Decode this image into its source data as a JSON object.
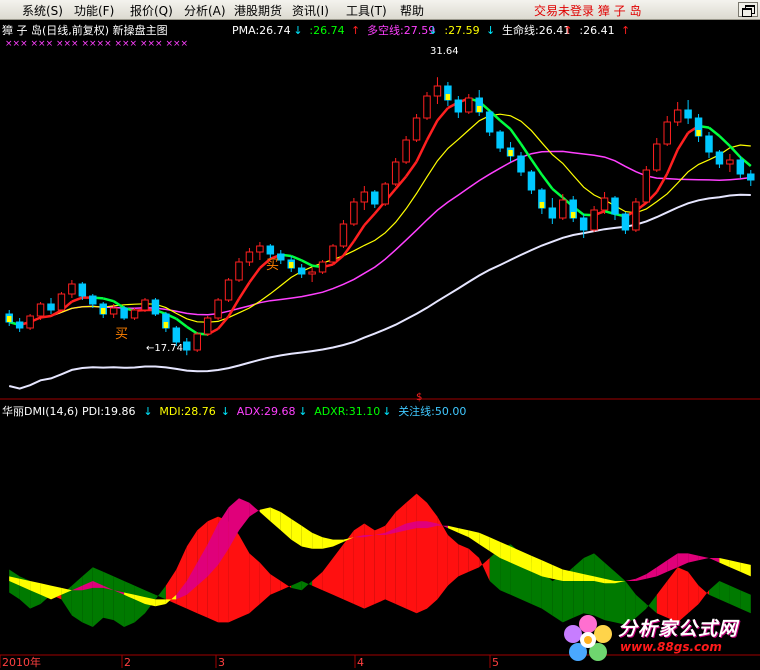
{
  "menu": {
    "items": [
      "系统(S)",
      "功能(F)",
      "报价(Q)",
      "分析(A)",
      "港股期货",
      "资讯(I)",
      "工具(T)",
      "帮助"
    ],
    "login_status": "交易未登录",
    "stock_name": "獐 子 岛"
  },
  "main_panel": {
    "title": "獐 子 岛(日线,前复权) 新操盘主图",
    "markers": "×××  ×××  ×××  ××××  ×××  ×××  ×××",
    "indicators": [
      {
        "label": "PMA:26.74",
        "arrow": "↓",
        "color": "#ffffff",
        "arrow_color": "#00e8ff"
      },
      {
        "label": ":26.74",
        "arrow": "↑",
        "color": "#00ff00",
        "arrow_color": "#ff2020"
      },
      {
        "label": "多空线:27.59",
        "arrow": "↓",
        "color": "#ff40ff",
        "arrow_color": "#00e8ff"
      },
      {
        "label": ":27.59",
        "arrow": "↓",
        "color": "#ffff00",
        "arrow_color": "#00e8ff"
      },
      {
        "label": "生命线:26.41",
        "arrow": "↑",
        "color": "#ffffff",
        "arrow_color": "#ff2020"
      },
      {
        "label": ":26.41",
        "arrow": "↑",
        "color": "#ffffff",
        "arrow_color": "#ff2020"
      }
    ],
    "high_label": "31.64",
    "low_label": "←17.74",
    "buy_label": "买"
  },
  "dmi_panel": {
    "title": "华丽DMI(14,6)",
    "indicators": [
      {
        "label": "PDI:19.86",
        "arrow": "↓",
        "color": "#ffffff"
      },
      {
        "label": "MDI:28.76",
        "arrow": "↓",
        "color": "#ffff00"
      },
      {
        "label": "ADX:29.68",
        "arrow": "↓",
        "color": "#ff40ff"
      },
      {
        "label": "ADXR:31.10",
        "arrow": "↓",
        "color": "#00ff00"
      },
      {
        "label": "关注线:50.00",
        "arrow": "",
        "color": "#40c8ff"
      }
    ]
  },
  "axis": {
    "ticks": [
      "2010年",
      "2",
      "3",
      "4",
      "5"
    ]
  },
  "watermark": {
    "title": "分析家公式网",
    "url": "www.88gs.com"
  },
  "chart_data": {
    "type": "candlestick",
    "price_scale_labels": {
      "high": 31.64,
      "low": 17.74
    },
    "ylim": [
      16.0,
      33.5
    ],
    "candles": [
      [
        19.8,
        20.0,
        19.2,
        19.4
      ],
      [
        19.4,
        19.6,
        18.9,
        19.1
      ],
      [
        19.1,
        19.8,
        19.0,
        19.7
      ],
      [
        19.7,
        20.4,
        19.5,
        20.3
      ],
      [
        20.3,
        20.6,
        19.8,
        20.0
      ],
      [
        20.0,
        20.9,
        19.9,
        20.8
      ],
      [
        20.8,
        21.5,
        20.6,
        21.3
      ],
      [
        21.3,
        21.4,
        20.5,
        20.7
      ],
      [
        20.7,
        20.8,
        20.1,
        20.3
      ],
      [
        20.3,
        20.4,
        19.6,
        19.8
      ],
      [
        19.8,
        20.3,
        19.6,
        20.1
      ],
      [
        20.1,
        20.2,
        19.5,
        19.6
      ],
      [
        19.6,
        20.1,
        19.5,
        20.0
      ],
      [
        20.0,
        20.6,
        19.9,
        20.5
      ],
      [
        20.5,
        20.6,
        19.7,
        19.8
      ],
      [
        19.8,
        19.9,
        18.9,
        19.1
      ],
      [
        19.1,
        19.2,
        18.2,
        18.4
      ],
      [
        18.4,
        18.6,
        17.74,
        18.0
      ],
      [
        18.0,
        18.9,
        17.9,
        18.8
      ],
      [
        18.8,
        19.7,
        18.7,
        19.6
      ],
      [
        19.6,
        20.6,
        19.5,
        20.5
      ],
      [
        20.5,
        21.6,
        20.4,
        21.5
      ],
      [
        21.5,
        22.6,
        21.4,
        22.4
      ],
      [
        22.4,
        23.1,
        22.2,
        22.9
      ],
      [
        22.9,
        23.4,
        22.5,
        23.2
      ],
      [
        23.2,
        23.3,
        22.6,
        22.8
      ],
      [
        22.8,
        23.0,
        22.3,
        22.5
      ],
      [
        22.5,
        22.7,
        21.9,
        22.1
      ],
      [
        22.1,
        22.3,
        21.6,
        21.8
      ],
      [
        21.8,
        22.1,
        21.4,
        21.9
      ],
      [
        21.9,
        22.5,
        21.8,
        22.4
      ],
      [
        22.4,
        23.3,
        22.3,
        23.2
      ],
      [
        23.2,
        24.5,
        23.1,
        24.3
      ],
      [
        24.3,
        25.6,
        24.2,
        25.4
      ],
      [
        25.4,
        26.2,
        25.0,
        25.9
      ],
      [
        25.9,
        26.0,
        25.1,
        25.3
      ],
      [
        25.3,
        26.4,
        25.2,
        26.3
      ],
      [
        26.3,
        27.6,
        26.2,
        27.4
      ],
      [
        27.4,
        28.7,
        27.3,
        28.5
      ],
      [
        28.5,
        29.8,
        28.4,
        29.6
      ],
      [
        29.6,
        30.9,
        29.5,
        30.7
      ],
      [
        30.7,
        31.64,
        30.3,
        31.2
      ],
      [
        31.2,
        31.4,
        30.2,
        30.5
      ],
      [
        30.5,
        30.7,
        29.6,
        29.9
      ],
      [
        29.9,
        30.8,
        29.8,
        30.6
      ],
      [
        30.6,
        31.0,
        29.7,
        29.9
      ],
      [
        29.9,
        30.0,
        28.7,
        28.9
      ],
      [
        28.9,
        29.0,
        27.9,
        28.1
      ],
      [
        28.1,
        28.4,
        27.4,
        27.7
      ],
      [
        27.7,
        27.9,
        26.7,
        26.9
      ],
      [
        26.9,
        27.0,
        25.8,
        26.0
      ],
      [
        26.0,
        26.1,
        24.8,
        25.1
      ],
      [
        25.1,
        25.6,
        24.3,
        24.6
      ],
      [
        24.6,
        25.8,
        24.5,
        25.5
      ],
      [
        25.5,
        25.7,
        24.4,
        24.6
      ],
      [
        24.6,
        24.8,
        23.6,
        24.0
      ],
      [
        24.0,
        25.2,
        23.9,
        25.0
      ],
      [
        25.0,
        25.9,
        24.8,
        25.6
      ],
      [
        25.6,
        25.7,
        24.5,
        24.8
      ],
      [
        24.8,
        24.9,
        23.8,
        24.0
      ],
      [
        24.0,
        25.6,
        23.9,
        25.4
      ],
      [
        25.4,
        27.2,
        25.3,
        27.0
      ],
      [
        27.0,
        28.6,
        26.9,
        28.3
      ],
      [
        28.3,
        29.7,
        28.2,
        29.4
      ],
      [
        29.4,
        30.4,
        29.2,
        30.0
      ],
      [
        30.0,
        30.5,
        29.3,
        29.6
      ],
      [
        29.6,
        29.8,
        28.4,
        28.7
      ],
      [
        28.7,
        28.9,
        27.6,
        27.9
      ],
      [
        27.9,
        28.0,
        27.1,
        27.3
      ],
      [
        27.3,
        27.8,
        26.9,
        27.5
      ],
      [
        27.5,
        27.7,
        26.6,
        26.8
      ],
      [
        26.8,
        27.0,
        26.2,
        26.5
      ]
    ],
    "dmi": {
      "ylim": [
        0,
        100
      ],
      "pdi": [
        25,
        22,
        18,
        20,
        24,
        22,
        15,
        12,
        10,
        14,
        13,
        10,
        12,
        16,
        22,
        28,
        35,
        45,
        52,
        56,
        58,
        56,
        50,
        42,
        38,
        33,
        30,
        27,
        26,
        30,
        34,
        40,
        46,
        52,
        55,
        52,
        54,
        60,
        64,
        68,
        64,
        58,
        50,
        46,
        44,
        40,
        30,
        26,
        24,
        22,
        20,
        18,
        15,
        12,
        14,
        16,
        15,
        13,
        12,
        11,
        14,
        18,
        24,
        30,
        36,
        34,
        28,
        24,
        22,
        20,
        18,
        16
      ],
      "mdi": [
        35,
        32,
        30,
        26,
        22,
        24,
        28,
        32,
        36,
        34,
        32,
        30,
        28,
        26,
        24,
        22,
        20,
        18,
        16,
        14,
        12,
        12,
        14,
        16,
        20,
        24,
        26,
        28,
        30,
        28,
        26,
        24,
        22,
        20,
        18,
        20,
        22,
        20,
        18,
        16,
        18,
        22,
        28,
        32,
        34,
        36,
        40,
        44,
        46,
        42,
        38,
        34,
        30,
        32,
        36,
        40,
        42,
        38,
        34,
        30,
        24,
        20,
        16,
        14,
        12,
        16,
        20,
        26,
        30,
        28,
        26,
        24
      ],
      "adx": [
        30,
        28,
        26,
        24,
        22,
        24,
        26,
        28,
        30,
        28,
        26,
        24,
        22,
        20,
        19,
        20,
        24,
        30,
        38,
        46,
        55,
        62,
        66,
        64,
        60,
        56,
        52,
        48,
        45,
        44,
        44,
        45,
        47,
        49,
        50,
        50,
        51,
        53,
        55,
        56,
        56,
        55,
        53,
        51,
        49,
        46,
        43,
        40,
        38,
        36,
        34,
        32,
        31,
        30,
        30,
        30,
        30,
        29,
        29,
        30,
        31,
        33,
        36,
        39,
        42,
        42,
        41,
        40,
        38,
        36,
        34,
        32
      ],
      "adxr": [
        32,
        31,
        30,
        29,
        28,
        27,
        26,
        26,
        27,
        27,
        26,
        25,
        24,
        23,
        22,
        22,
        22,
        24,
        28,
        32,
        37,
        44,
        52,
        58,
        61,
        62,
        60,
        57,
        54,
        51,
        49,
        48,
        48,
        49,
        49,
        50,
        50,
        51,
        52,
        53,
        53,
        54,
        54,
        53,
        52,
        51,
        49,
        47,
        45,
        43,
        41,
        39,
        37,
        35,
        34,
        33,
        32,
        31,
        30,
        30,
        30,
        31,
        32,
        34,
        36,
        38,
        39,
        40,
        40,
        39,
        38,
        37
      ],
      "focus": 50
    }
  }
}
